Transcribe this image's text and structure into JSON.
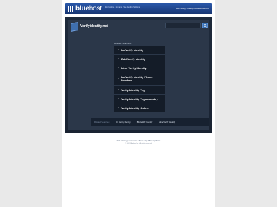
{
  "banner": {
    "brand_prefix": "blue",
    "brand_suffix": "host",
    "tagline": "Web Hosting · Domains · Site Building Solutions",
    "right_text": "Web Hosting - courtesy of www.bluehost.com"
  },
  "site": {
    "title": "Verifyidentity.net",
    "search_placeholder": "",
    "related_label": "Related Searches:"
  },
  "links": [
    {
      "label": "Irs Verify Identity"
    },
    {
      "label": "Bdd Verify Identity"
    },
    {
      "label": "Idme Verify Identity"
    },
    {
      "label": "Irs Verify Identity Phone Number"
    },
    {
      "label": "Verify Identity Trig"
    },
    {
      "label": "Verify Identity Trigonometry"
    },
    {
      "label": "Verify Identity Online"
    }
  ],
  "bottom_bar": {
    "label": "Related Searches:",
    "links": [
      "Irs Verify Identity",
      "Bdd Verify Identity",
      "Idme Verify Identity"
    ]
  },
  "footer": {
    "links": "Web Hosting | Contact Us | Terms of | Affiliates | Terms",
    "copyright": "© 2024 Bluehost Inc. All rights reserved."
  },
  "colors": {
    "banner_blue": "#1c3f86",
    "panel_dark": "#1b2535",
    "button_dark": "#141c28",
    "accent_blue": "#3b73b8"
  }
}
